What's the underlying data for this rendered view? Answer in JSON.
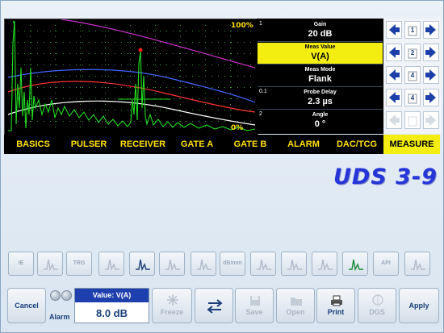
{
  "scope": {
    "top_label": "100%",
    "bottom_label": "0%"
  },
  "params": [
    {
      "index": "1",
      "title": "Gain",
      "value": "20 dB",
      "selected": false
    },
    {
      "index": "",
      "title": "Meas Value",
      "value": "V(A)",
      "selected": true
    },
    {
      "index": "",
      "title": "Meas Mode",
      "value": "Flank",
      "selected": false
    },
    {
      "index": "0.1",
      "title": "Probe Delay",
      "value": "2.3 µs",
      "selected": false
    },
    {
      "index": "2",
      "title": "Angle",
      "value": "0 °",
      "selected": false
    }
  ],
  "step_digits": [
    "1",
    "2",
    "4",
    "4",
    ""
  ],
  "menu": [
    "BASICS",
    "PULSER",
    "RECEIVER",
    "GATE A",
    "GATE B",
    "ALARM",
    "DAC/TCG",
    "MEASURE"
  ],
  "menu_active": "MEASURE",
  "logo": "UDS 3-9",
  "toolbar": [
    "IE",
    "",
    "TRG",
    "",
    "",
    "",
    "",
    "dB/mm",
    "",
    "",
    "",
    "",
    "API",
    ""
  ],
  "bottom": {
    "cancel": "Cancel",
    "alarm": "Alarm",
    "value_header": "Value: V(A)",
    "value": "8.0 dB",
    "freeze": "Freeze",
    "save": "Save",
    "open": "Open",
    "print": "Print",
    "dgs": "DGS",
    "apply": "Apply"
  },
  "colors": {
    "screen_bg": "#000000",
    "highlight": "#f4ee10",
    "menu_text": "#ffe000",
    "signal": "#22dd22",
    "curve_magenta": "#cc33cc",
    "curve_blue": "#4466ff",
    "curve_red": "#ff3333",
    "curve_white": "#ffffff",
    "logo": "#2535d8"
  }
}
